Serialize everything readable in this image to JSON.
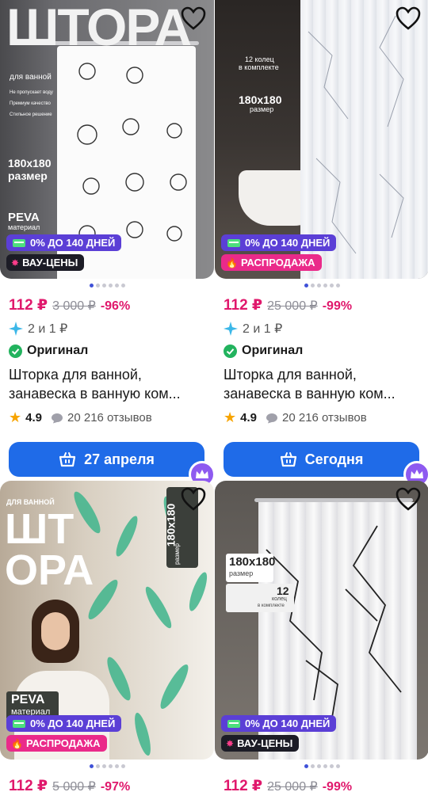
{
  "products": [
    {
      "image_text": {
        "big": "ШТОРА",
        "sub": "для ванной",
        "size": "180х180",
        "size_label": "размер",
        "material": "PEVA",
        "material_label": "материал",
        "features": [
          "Не пропускает воду",
          "Премиум качество",
          "Стильное решение"
        ]
      },
      "badge_installment": "0% ДО 140 ДНЕЙ",
      "badge_promo": "ВАУ-ЦЕНЫ",
      "promo_style": "dark",
      "price": "112 ₽",
      "old_price": "3 000 ₽",
      "discount": "-96%",
      "bonus": "2 и 1 ₽",
      "original_label": "Оригинал",
      "title_line1": "Шторка для ванной,",
      "title_line2": "занавеска в ванную ком...",
      "rating": "4.9",
      "reviews": "20 216 отзывов",
      "delivery": "27 апреля"
    },
    {
      "image_text": {
        "rings": "12 колец",
        "rings_label": "в комплекте",
        "size": "180х180",
        "size_label": "размер"
      },
      "badge_installment": "0% ДО 140 ДНЕЙ",
      "badge_promo": "РАСПРОДАЖА",
      "promo_style": "pink",
      "price": "112 ₽",
      "old_price": "25 000 ₽",
      "discount": "-99%",
      "bonus": "2 и 1 ₽",
      "original_label": "Оригинал",
      "title_line1": "Шторка для ванной,",
      "title_line2": "занавеска в ванную ком...",
      "rating": "4.9",
      "reviews": "20 216 отзывов",
      "delivery": "Сегодня"
    },
    {
      "image_text": {
        "big1": "ШТ",
        "big2": "ОРА",
        "sub": "ДЛЯ ВАННОЙ",
        "size": "180х180",
        "size_label": "размер",
        "material": "PEVA",
        "material_label": "материал"
      },
      "badge_installment": "0% ДО 140 ДНЕЙ",
      "badge_promo": "РАСПРОДАЖА",
      "promo_style": "pink",
      "price": "112 ₽",
      "old_price": "5 000 ₽",
      "discount": "-97%"
    },
    {
      "image_text": {
        "size": "180х180",
        "size_label": "размер",
        "rings": "12",
        "rings_label1": "колец",
        "rings_label2": "в комплекте"
      },
      "badge_installment": "0% ДО 140 ДНЕЙ",
      "badge_promo": "ВАУ-ЦЕНЫ",
      "promo_style": "dark",
      "price": "112 ₽",
      "old_price": "25 000 ₽",
      "discount": "-99%"
    }
  ],
  "colors": {
    "price": "#e0186c",
    "button": "#1f6be8",
    "installment": "#5b3fd6",
    "sale": "#ea2a8a",
    "original": "#22b35e",
    "bonus": "#3bb7e8"
  }
}
